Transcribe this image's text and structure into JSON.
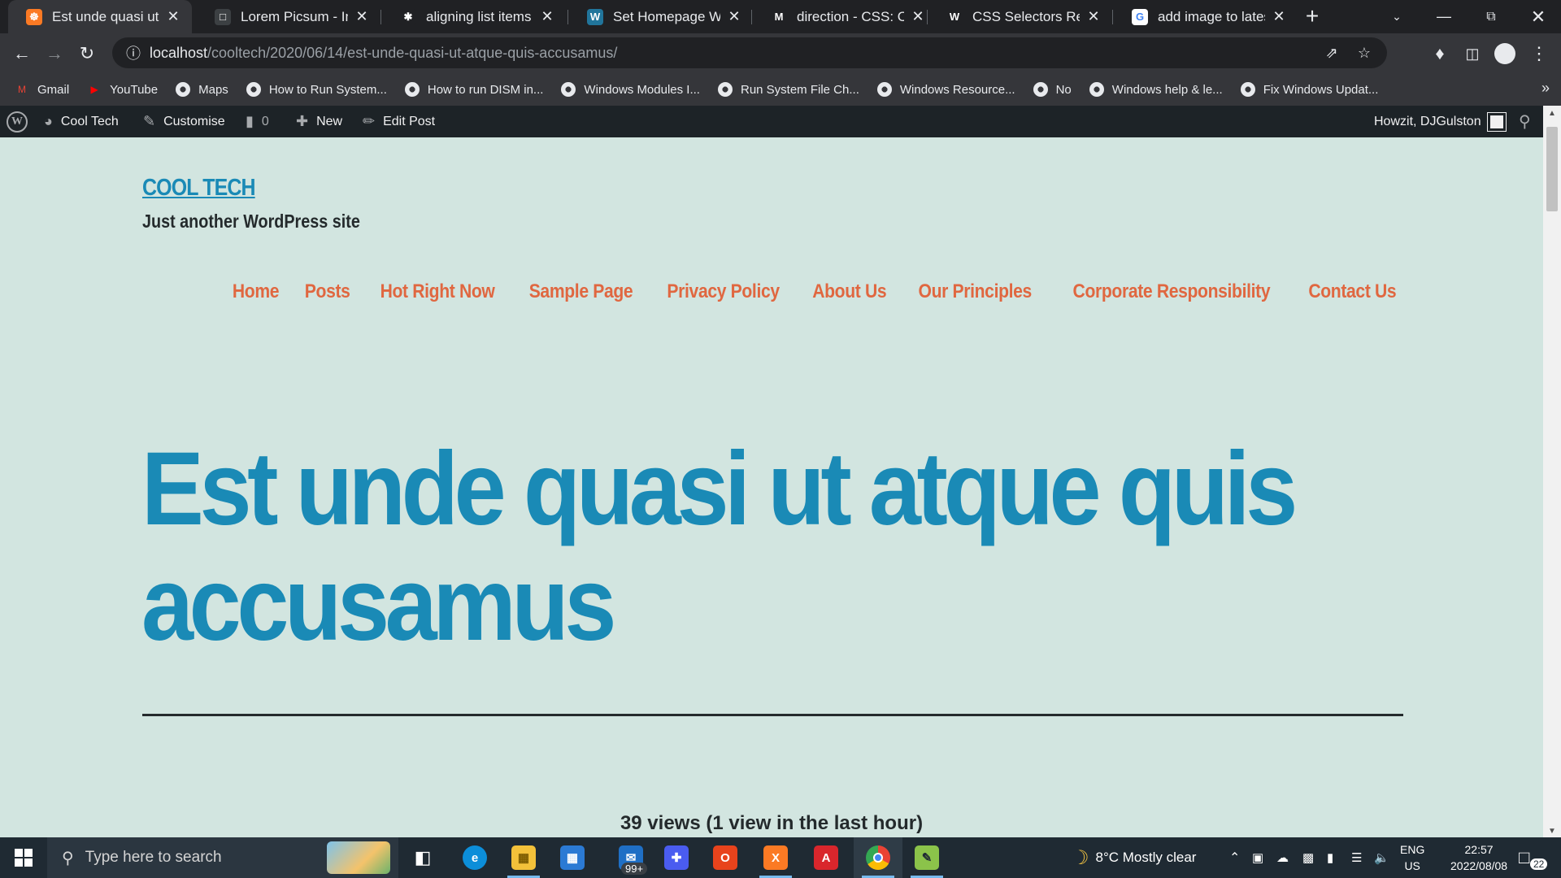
{
  "browser": {
    "tabs": [
      {
        "title": "Est unde quasi ut atque",
        "icon": "xampp-icon",
        "color": "#fb7a24",
        "glyph": "☸",
        "active": true
      },
      {
        "title": "Lorem Picsum - Images",
        "icon": "picsum-icon",
        "color": "#3c4043",
        "glyph": "□",
        "active": false
      },
      {
        "title": "aligning list items and",
        "icon": "asterisk-icon",
        "color": "#202124",
        "glyph": "✱",
        "active": false
      },
      {
        "title": "Set Homepage WordPress",
        "icon": "wordpress-icon",
        "color": "#21759b",
        "glyph": "W",
        "active": false
      },
      {
        "title": "direction - CSS: Cascading",
        "icon": "mdn-icon",
        "color": "#202124",
        "glyph": "M",
        "active": false
      },
      {
        "title": "CSS Selectors Reference",
        "icon": "w3schools-icon",
        "color": "#202124",
        "glyph": "W",
        "active": false
      },
      {
        "title": "add image to latest posts",
        "icon": "google-icon",
        "color": "#ffffff",
        "glyph": "G",
        "active": false
      }
    ],
    "url_host": "localhost",
    "url_path": "/cooltech/2020/06/14/est-unde-quasi-ut-atque-quis-accusamus/",
    "bookmarks": [
      {
        "label": "Gmail",
        "icon": "gmail-icon",
        "color": "#ea4335",
        "glyph": "M"
      },
      {
        "label": "YouTube",
        "icon": "youtube-icon",
        "color": "#ff0000",
        "glyph": "▶"
      },
      {
        "label": "Maps",
        "icon": "globe-icon",
        "color": "#e8eaed",
        "glyph": ""
      },
      {
        "label": "How to Run System...",
        "icon": "globe-icon",
        "color": "#e8eaed",
        "glyph": ""
      },
      {
        "label": "How to run DISM in...",
        "icon": "globe-icon",
        "color": "#e8eaed",
        "glyph": ""
      },
      {
        "label": "Windows Modules I...",
        "icon": "globe-icon",
        "color": "#e8eaed",
        "glyph": ""
      },
      {
        "label": "Run System File Ch...",
        "icon": "globe-icon",
        "color": "#e8eaed",
        "glyph": ""
      },
      {
        "label": "Windows Resource...",
        "icon": "globe-icon",
        "color": "#e8eaed",
        "glyph": ""
      },
      {
        "label": "No",
        "icon": "globe-icon",
        "color": "#e8eaed",
        "glyph": ""
      },
      {
        "label": "Windows help & le...",
        "icon": "globe-icon",
        "color": "#e8eaed",
        "glyph": ""
      },
      {
        "label": "Fix Windows Updat...",
        "icon": "globe-icon",
        "color": "#e8eaed",
        "glyph": ""
      }
    ]
  },
  "wp_admin": {
    "site_name": "Cool Tech",
    "customise": "Customise",
    "comments_count": "0",
    "new": "New",
    "edit_post": "Edit Post",
    "greeting": "Howzit, DJGulston"
  },
  "site": {
    "title": "COOL TECH",
    "tagline": "Just another WordPress site",
    "nav": [
      "Home",
      "Posts",
      "Hot Right Now",
      "Sample Page",
      "Privacy Policy",
      "About Us",
      "Our Principles",
      "Corporate Responsibility",
      "Contact Us"
    ],
    "post_title": "Est unde quasi ut atque quis accusamus",
    "views": "39 views (1 view in the last hour)"
  },
  "taskbar": {
    "search_placeholder": "Type here to search",
    "mail_badge": "99+",
    "weather": "8°C  Mostly clear",
    "lang_top": "ENG",
    "lang_bottom": "US",
    "time": "22:57",
    "date": "2022/08/08",
    "notifications": "22"
  },
  "colors": {
    "page_bg": "#d2e5e0",
    "accent_blue": "#1a8ab6",
    "nav_orange": "#e06740",
    "text_dark": "#242a2c"
  }
}
